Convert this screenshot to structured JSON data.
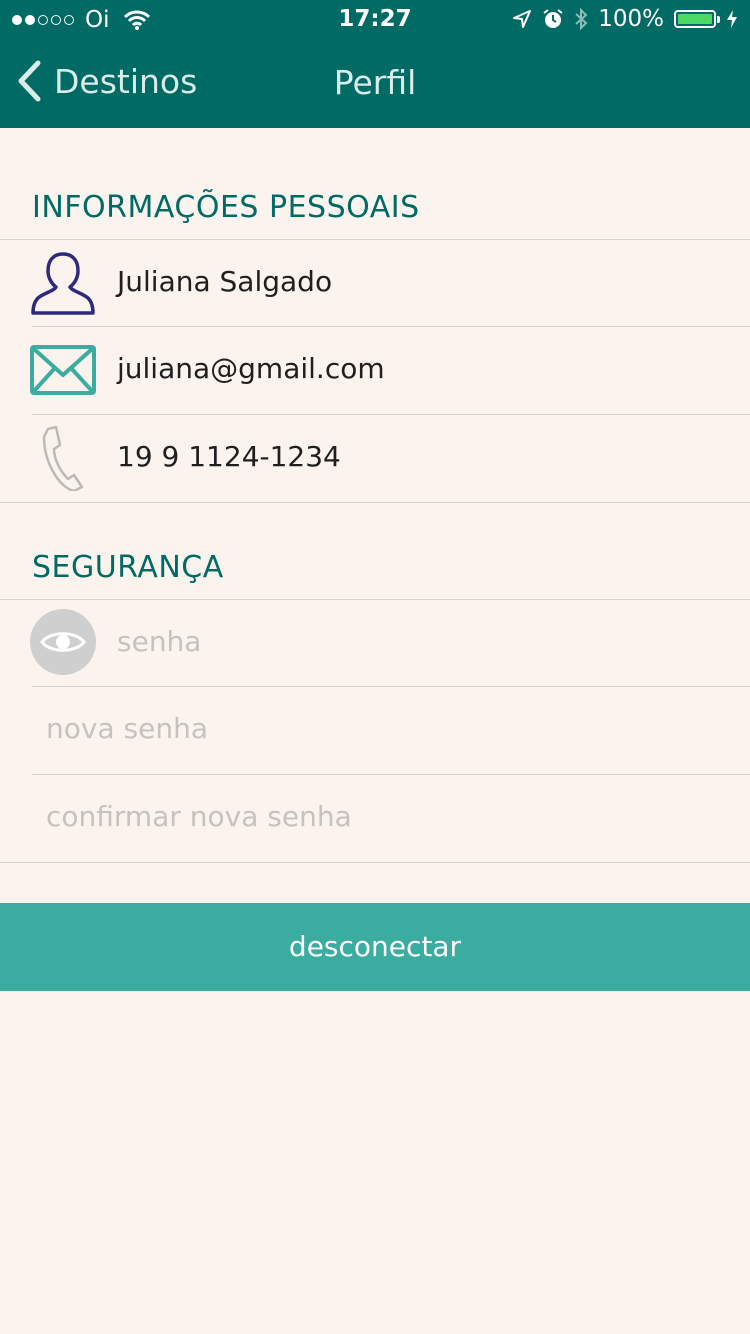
{
  "status_bar": {
    "carrier": "Oi",
    "time": "17:27",
    "battery": "100%",
    "signal_bars_filled": 2,
    "signal_bars_total": 5
  },
  "nav": {
    "back_label": "Destinos",
    "title": "Perfil"
  },
  "personal": {
    "header": "INFORMAÇÕES PESSOAIS",
    "name": "Juliana Salgado",
    "email": "juliana@gmail.com",
    "phone": "19 9 1124-1234"
  },
  "security": {
    "header": "SEGURANÇA",
    "password_placeholder": "senha",
    "new_password_placeholder": "nova senha",
    "confirm_password_placeholder": "confirmar nova senha"
  },
  "logout_label": "desconectar",
  "colors": {
    "nav_bar": "#006a65",
    "accent": "#3aaca0",
    "background": "#fbf4ee",
    "user_icon": "#2e2b7f",
    "mail_icon": "#3aaca0"
  },
  "icons": {
    "back": "chevron-left-icon",
    "name": "user-icon",
    "email": "mail-icon",
    "phone": "phone-icon",
    "password": "eye-icon"
  }
}
